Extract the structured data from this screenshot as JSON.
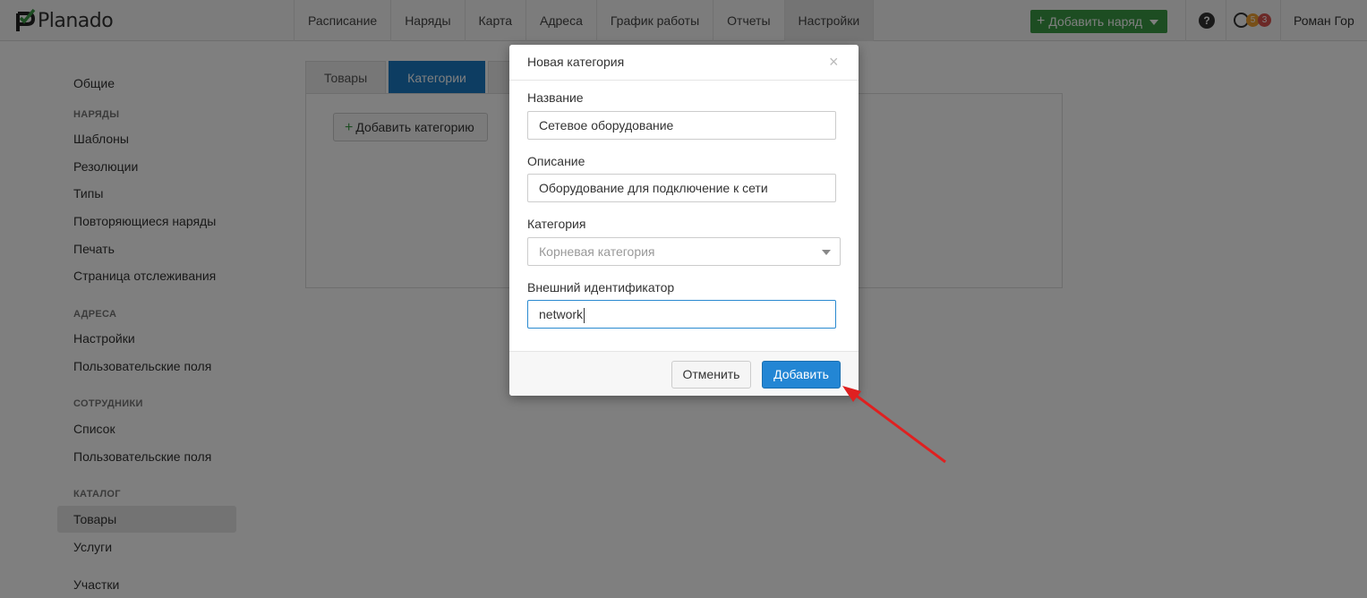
{
  "app": {
    "logo_text": "Planado"
  },
  "navbar": {
    "items": [
      "Расписание",
      "Наряды",
      "Карта",
      "Адреса",
      "График работы",
      "Отчеты",
      "Настройки"
    ],
    "add_order_label": "Добавить наряд",
    "help_label": "?",
    "badge_orange": "5",
    "badge_red": "3",
    "user_name": "Роман Гор"
  },
  "sidebar": {
    "general": "Общие",
    "orders_heading": "НАРЯДЫ",
    "templates": "Шаблоны",
    "resolutions": "Резолюции",
    "types": "Типы",
    "recurring": "Повторяющиеся наряды",
    "print": "Печать",
    "tracking": "Страница отслеживания",
    "addresses_heading": "АДРЕСА",
    "addr_settings": "Настройки",
    "addr_custom_fields": "Пользовательские поля",
    "employees_heading": "СОТРУДНИКИ",
    "emp_list": "Список",
    "emp_custom_fields": "Пользовательские поля",
    "catalog_heading": "КАТАЛОГ",
    "goods": "Товары",
    "services": "Услуги",
    "areas": "Участки"
  },
  "content": {
    "tab_goods": "Товары",
    "tab_categories": "Категории",
    "add_category_label": "Добавить категорию"
  },
  "modal": {
    "title": "Новая категория",
    "close": "×",
    "name_label": "Название",
    "name_value": "Сетевое оборудование",
    "description_label": "Описание",
    "description_value": "Оборудование для подключение к сети",
    "category_label": "Категория",
    "category_placeholder": "Корневая категория",
    "external_id_label": "Внешний идентификатор",
    "external_id_value": "network",
    "cancel_label": "Отменить",
    "add_label": "Добавить"
  },
  "colors": {
    "accent": "#2386d4",
    "success": "#3a9a45",
    "annotation_arrow": "#e02020"
  }
}
